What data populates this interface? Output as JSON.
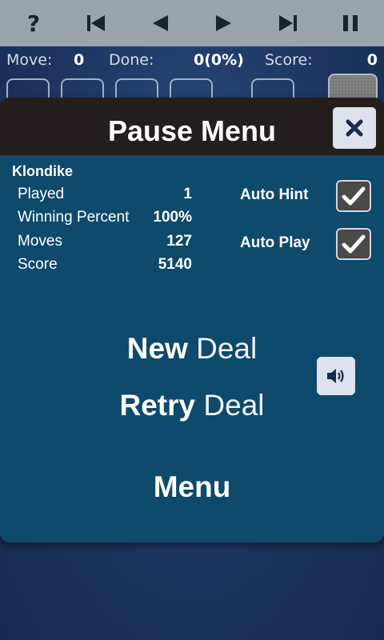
{
  "toolbar": {
    "help_glyph": "?",
    "icons": [
      "help-icon",
      "skip-to-start-icon",
      "step-back-icon",
      "step-forward-icon",
      "skip-to-end-icon",
      "pause-icon"
    ]
  },
  "status": {
    "move_label": "Move:",
    "move_value": "0",
    "done_label": "Done:",
    "done_value": "0(0%)",
    "score_label": "Score:",
    "score_value": "0"
  },
  "pause_menu": {
    "title": "Pause Menu",
    "close_icon": "close-icon",
    "game_name": "Klondike",
    "stats": [
      {
        "label": "Played",
        "value": "1"
      },
      {
        "label": "Winning Percent",
        "value": "100%"
      },
      {
        "label": "Moves",
        "value": "127"
      },
      {
        "label": "Score",
        "value": "5140"
      }
    ],
    "options": [
      {
        "label": "Auto Hint",
        "checked": true
      },
      {
        "label": "Auto Play",
        "checked": true
      }
    ],
    "actions": [
      {
        "bold": "New",
        "light": "Deal"
      },
      {
        "bold": "Retry",
        "light": "Deal"
      },
      {
        "bold": "Menu",
        "light": ""
      }
    ],
    "sound_icon": "speaker-icon"
  },
  "colors": {
    "toolbar_bg": "#9ba3af",
    "panel_bg": "#0e4a6b",
    "header_bg": "#241e1d",
    "background": "#1d3560"
  }
}
